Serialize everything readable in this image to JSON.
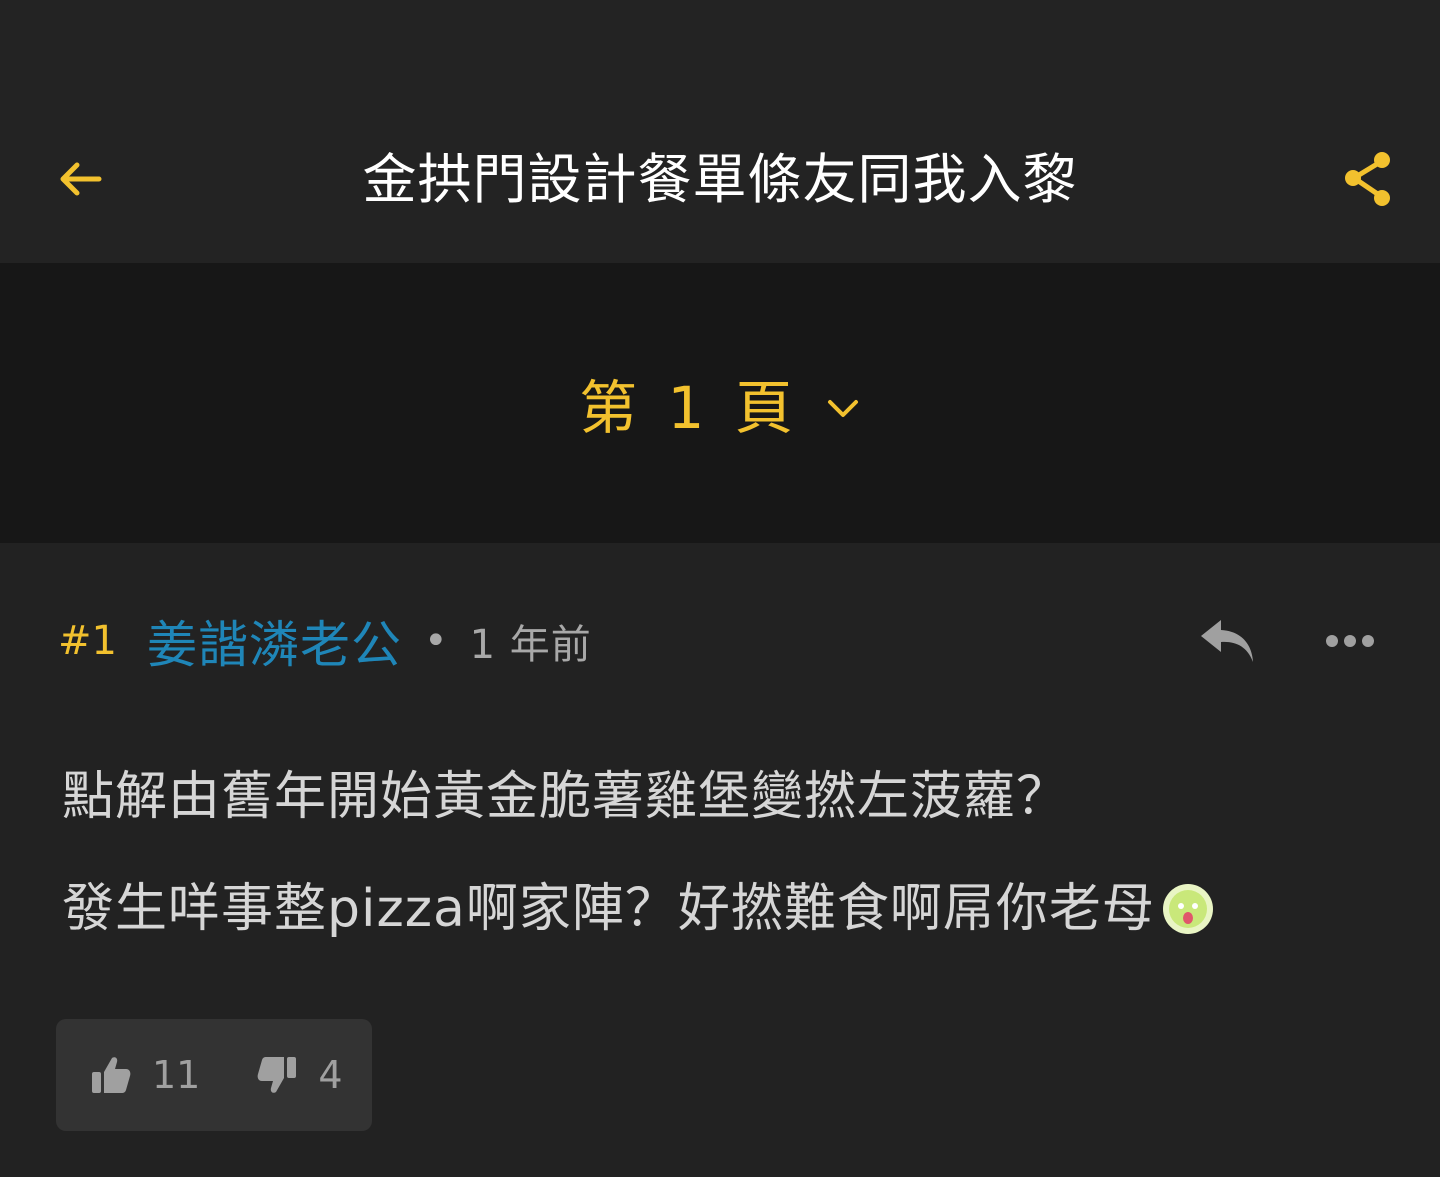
{
  "header": {
    "title": "金拱門設計餐單條友同我入黎",
    "back_icon": "arrow-left-icon",
    "share_icon": "share-icon",
    "accent_color": "#f2c12e"
  },
  "pagination": {
    "label": "第 1 頁",
    "dropdown_icon": "chevron-down-icon"
  },
  "post": {
    "number": "#1",
    "username": "姜諧潾老公",
    "separator": "•",
    "time": "1 年前",
    "reply_icon": "reply-icon",
    "more_icon": "more-horizontal-icon",
    "body_line_1": "點解由舊年開始黃金脆薯雞堡變撚左菠蘿？",
    "body_line_2": "發生咩事整pizza啊家陣？好撚難食啊屌你老母",
    "emoji_icon": "sticker-emoji-icon",
    "likes": "11",
    "dislikes": "4",
    "like_icon": "thumbs-up-icon",
    "dislike_icon": "thumbs-down-icon",
    "username_color": "#1f86b8"
  }
}
